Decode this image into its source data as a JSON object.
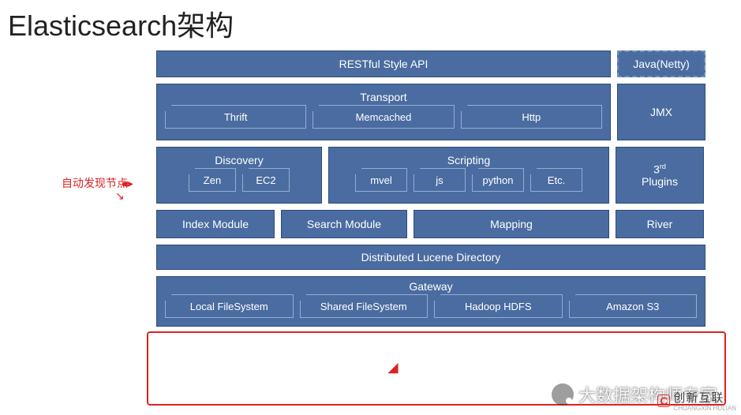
{
  "title": "Elasticsearch架构",
  "annotation": "自动发现节点",
  "row1": {
    "api": "RESTful Style API",
    "netty": "Java(Netty)"
  },
  "row2": {
    "transport": "Transport",
    "items": [
      "Thrift",
      "Memcached",
      "Http"
    ],
    "jmx": "JMX"
  },
  "row3": {
    "discovery": "Discovery",
    "disc_items": [
      "Zen",
      "EC2"
    ],
    "scripting": "Scripting",
    "script_items": [
      "mvel",
      "js",
      "python",
      "Etc."
    ],
    "plugins_top": "3",
    "plugins_sup": "rd",
    "plugins_bottom": "Plugins"
  },
  "row4": {
    "index": "Index Module",
    "search": "Search Module",
    "mapping": "Mapping",
    "river": "River"
  },
  "row5": "Distributed Lucene Directory",
  "row6": {
    "gateway": "Gateway",
    "items": [
      "Local FileSystem",
      "Shared FileSystem",
      "Hadoop HDFS",
      "Amazon S3"
    ]
  },
  "watermark": "大数据架构师专家",
  "brand_cn": "创新互联",
  "brand_en": "CHUANGXIN HULIAN"
}
